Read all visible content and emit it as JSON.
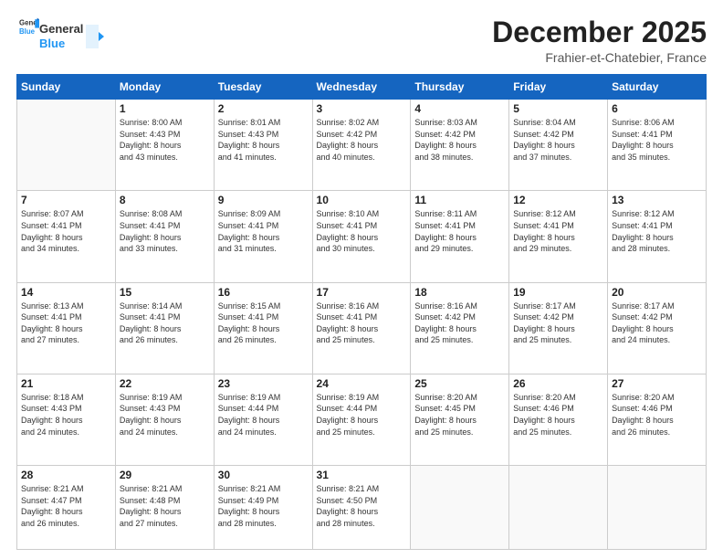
{
  "header": {
    "logo": {
      "general": "General",
      "blue": "Blue"
    },
    "title": "December 2025",
    "location": "Frahier-et-Chatebier, France"
  },
  "calendar": {
    "days_of_week": [
      "Sunday",
      "Monday",
      "Tuesday",
      "Wednesday",
      "Thursday",
      "Friday",
      "Saturday"
    ],
    "weeks": [
      [
        {
          "day": "",
          "content": ""
        },
        {
          "day": "1",
          "content": "Sunrise: 8:00 AM\nSunset: 4:43 PM\nDaylight: 8 hours\nand 43 minutes."
        },
        {
          "day": "2",
          "content": "Sunrise: 8:01 AM\nSunset: 4:43 PM\nDaylight: 8 hours\nand 41 minutes."
        },
        {
          "day": "3",
          "content": "Sunrise: 8:02 AM\nSunset: 4:42 PM\nDaylight: 8 hours\nand 40 minutes."
        },
        {
          "day": "4",
          "content": "Sunrise: 8:03 AM\nSunset: 4:42 PM\nDaylight: 8 hours\nand 38 minutes."
        },
        {
          "day": "5",
          "content": "Sunrise: 8:04 AM\nSunset: 4:42 PM\nDaylight: 8 hours\nand 37 minutes."
        },
        {
          "day": "6",
          "content": "Sunrise: 8:06 AM\nSunset: 4:41 PM\nDaylight: 8 hours\nand 35 minutes."
        }
      ],
      [
        {
          "day": "7",
          "content": "Sunrise: 8:07 AM\nSunset: 4:41 PM\nDaylight: 8 hours\nand 34 minutes."
        },
        {
          "day": "8",
          "content": "Sunrise: 8:08 AM\nSunset: 4:41 PM\nDaylight: 8 hours\nand 33 minutes."
        },
        {
          "day": "9",
          "content": "Sunrise: 8:09 AM\nSunset: 4:41 PM\nDaylight: 8 hours\nand 31 minutes."
        },
        {
          "day": "10",
          "content": "Sunrise: 8:10 AM\nSunset: 4:41 PM\nDaylight: 8 hours\nand 30 minutes."
        },
        {
          "day": "11",
          "content": "Sunrise: 8:11 AM\nSunset: 4:41 PM\nDaylight: 8 hours\nand 29 minutes."
        },
        {
          "day": "12",
          "content": "Sunrise: 8:12 AM\nSunset: 4:41 PM\nDaylight: 8 hours\nand 29 minutes."
        },
        {
          "day": "13",
          "content": "Sunrise: 8:12 AM\nSunset: 4:41 PM\nDaylight: 8 hours\nand 28 minutes."
        }
      ],
      [
        {
          "day": "14",
          "content": "Sunrise: 8:13 AM\nSunset: 4:41 PM\nDaylight: 8 hours\nand 27 minutes."
        },
        {
          "day": "15",
          "content": "Sunrise: 8:14 AM\nSunset: 4:41 PM\nDaylight: 8 hours\nand 26 minutes."
        },
        {
          "day": "16",
          "content": "Sunrise: 8:15 AM\nSunset: 4:41 PM\nDaylight: 8 hours\nand 26 minutes."
        },
        {
          "day": "17",
          "content": "Sunrise: 8:16 AM\nSunset: 4:41 PM\nDaylight: 8 hours\nand 25 minutes."
        },
        {
          "day": "18",
          "content": "Sunrise: 8:16 AM\nSunset: 4:42 PM\nDaylight: 8 hours\nand 25 minutes."
        },
        {
          "day": "19",
          "content": "Sunrise: 8:17 AM\nSunset: 4:42 PM\nDaylight: 8 hours\nand 25 minutes."
        },
        {
          "day": "20",
          "content": "Sunrise: 8:17 AM\nSunset: 4:42 PM\nDaylight: 8 hours\nand 24 minutes."
        }
      ],
      [
        {
          "day": "21",
          "content": "Sunrise: 8:18 AM\nSunset: 4:43 PM\nDaylight: 8 hours\nand 24 minutes."
        },
        {
          "day": "22",
          "content": "Sunrise: 8:19 AM\nSunset: 4:43 PM\nDaylight: 8 hours\nand 24 minutes."
        },
        {
          "day": "23",
          "content": "Sunrise: 8:19 AM\nSunset: 4:44 PM\nDaylight: 8 hours\nand 24 minutes."
        },
        {
          "day": "24",
          "content": "Sunrise: 8:19 AM\nSunset: 4:44 PM\nDaylight: 8 hours\nand 25 minutes."
        },
        {
          "day": "25",
          "content": "Sunrise: 8:20 AM\nSunset: 4:45 PM\nDaylight: 8 hours\nand 25 minutes."
        },
        {
          "day": "26",
          "content": "Sunrise: 8:20 AM\nSunset: 4:46 PM\nDaylight: 8 hours\nand 25 minutes."
        },
        {
          "day": "27",
          "content": "Sunrise: 8:20 AM\nSunset: 4:46 PM\nDaylight: 8 hours\nand 26 minutes."
        }
      ],
      [
        {
          "day": "28",
          "content": "Sunrise: 8:21 AM\nSunset: 4:47 PM\nDaylight: 8 hours\nand 26 minutes."
        },
        {
          "day": "29",
          "content": "Sunrise: 8:21 AM\nSunset: 4:48 PM\nDaylight: 8 hours\nand 27 minutes."
        },
        {
          "day": "30",
          "content": "Sunrise: 8:21 AM\nSunset: 4:49 PM\nDaylight: 8 hours\nand 28 minutes."
        },
        {
          "day": "31",
          "content": "Sunrise: 8:21 AM\nSunset: 4:50 PM\nDaylight: 8 hours\nand 28 minutes."
        },
        {
          "day": "",
          "content": ""
        },
        {
          "day": "",
          "content": ""
        },
        {
          "day": "",
          "content": ""
        }
      ]
    ]
  }
}
